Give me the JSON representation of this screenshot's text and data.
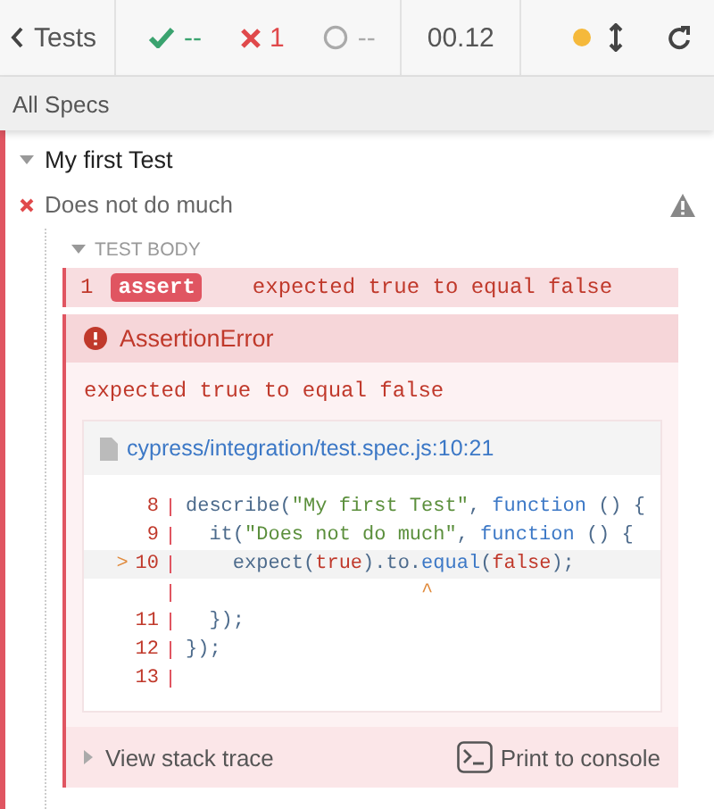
{
  "header": {
    "back_label": "Tests",
    "passed": "--",
    "failed": "1",
    "pending": "--",
    "duration": "00.12"
  },
  "breadcrumb": "All Specs",
  "suite": {
    "title": "My first Test",
    "expanded": true,
    "tests": [
      {
        "title": "Does not do much",
        "failed": true,
        "body_label": "TEST BODY",
        "body_expanded": true,
        "commands": [
          {
            "number": "1",
            "name": "assert",
            "message": "expected true to equal false",
            "failed": true
          }
        ],
        "error": {
          "name": "AssertionError",
          "message": "expected true to equal false",
          "file": "cypress/integration/test.spec.js:10:21",
          "code_lines": [
            {
              "kind": "line",
              "number": "8",
              "current": false,
              "tokens": [
                {
                  "kind": "plain",
                  "text": "describe("
                },
                {
                  "kind": "string",
                  "text": "\"My first Test\""
                },
                {
                  "kind": "plain",
                  "text": ", "
                },
                {
                  "kind": "keyword",
                  "text": "function"
                },
                {
                  "kind": "plain",
                  "text": " () {"
                }
              ]
            },
            {
              "kind": "line",
              "number": "9",
              "current": false,
              "tokens": [
                {
                  "kind": "plain",
                  "text": "  it("
                },
                {
                  "kind": "string",
                  "text": "\"Does not do much\""
                },
                {
                  "kind": "plain",
                  "text": ", "
                },
                {
                  "kind": "keyword",
                  "text": "function"
                },
                {
                  "kind": "plain",
                  "text": " () {"
                }
              ]
            },
            {
              "kind": "line",
              "number": "10",
              "current": true,
              "pointer": ">",
              "tokens": [
                {
                  "kind": "plain",
                  "text": "    expect("
                },
                {
                  "kind": "literal",
                  "text": "true"
                },
                {
                  "kind": "plain",
                  "text": ").to."
                },
                {
                  "kind": "keyword",
                  "text": "equal"
                },
                {
                  "kind": "plain",
                  "text": "("
                },
                {
                  "kind": "literal",
                  "text": "false"
                },
                {
                  "kind": "plain",
                  "text": ");"
                }
              ]
            },
            {
              "kind": "caret",
              "marker": "                    ^"
            },
            {
              "kind": "line",
              "number": "11",
              "current": false,
              "tokens": [
                {
                  "kind": "plain",
                  "text": "  });"
                }
              ]
            },
            {
              "kind": "line",
              "number": "12",
              "current": false,
              "tokens": [
                {
                  "kind": "plain",
                  "text": "});"
                }
              ]
            },
            {
              "kind": "line",
              "number": "13",
              "current": false
            }
          ],
          "stack_trace_label": "View stack trace",
          "print_label": "Print to console"
        }
      }
    ]
  }
}
